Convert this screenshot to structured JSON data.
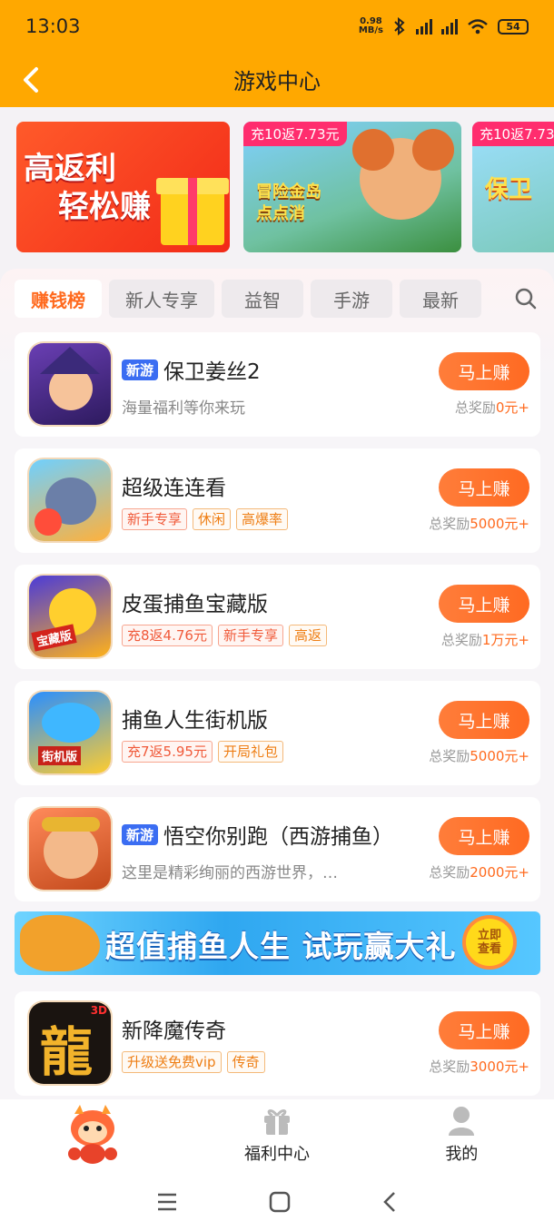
{
  "status_bar": {
    "time": "13:03",
    "net_speed_value": "0.98",
    "net_speed_unit": "MB/s",
    "battery": "54"
  },
  "nav": {
    "title": "游戏中心"
  },
  "banners": [
    {
      "line1": "高返利",
      "line2": "轻松赚"
    },
    {
      "tag": "充10返7.73元",
      "art_text": "冒险金岛点点消"
    },
    {
      "tag": "充10返7.73",
      "art_text": "保卫"
    }
  ],
  "tabs": [
    "赚钱榜",
    "新人专享",
    "益智",
    "手游",
    "最新"
  ],
  "games": [
    {
      "name": "保卫姜丝2",
      "badge": "新游",
      "desc": "海量福利等你来玩",
      "tags": [],
      "button": "马上赚",
      "reward_prefix": "总奖励",
      "reward_value": "0元+"
    },
    {
      "name": "超级连连看",
      "badge": "",
      "desc": "",
      "tags": [
        {
          "text": "新手专享",
          "style": "red"
        },
        {
          "text": "休闲",
          "style": "orange"
        },
        {
          "text": "高爆率",
          "style": "orange"
        }
      ],
      "button": "马上赚",
      "reward_prefix": "总奖励",
      "reward_value": "5000元+"
    },
    {
      "name": "皮蛋捕鱼宝藏版",
      "badge": "",
      "desc": "",
      "tags": [
        {
          "text": "充8返4.76元",
          "style": "red"
        },
        {
          "text": "新手专享",
          "style": "red"
        },
        {
          "text": "高返",
          "style": "orange"
        }
      ],
      "button": "马上赚",
      "reward_prefix": "总奖励",
      "reward_value": "1万元+"
    },
    {
      "name": "捕鱼人生街机版",
      "badge": "",
      "desc": "",
      "tags": [
        {
          "text": "充7返5.95元",
          "style": "red"
        },
        {
          "text": "开局礼包",
          "style": "orange"
        }
      ],
      "button": "马上赚",
      "reward_prefix": "总奖励",
      "reward_value": "5000元+"
    },
    {
      "name": "悟空你别跑（西游捕鱼）",
      "badge": "新游",
      "desc": "这里是精彩绚丽的西游世界，…",
      "tags": [],
      "button": "马上赚",
      "reward_prefix": "总奖励",
      "reward_value": "2000元+"
    },
    {
      "name": "新降魔传奇",
      "badge": "",
      "desc": "",
      "tags": [
        {
          "text": "升级送免费vip",
          "style": "orange"
        },
        {
          "text": "传奇",
          "style": "orange"
        }
      ],
      "button": "马上赚",
      "reward_prefix": "总奖励",
      "reward_value": "3000元+"
    }
  ],
  "promo": {
    "text": "超值捕鱼人生 试玩赢大礼",
    "cta_line1": "立即",
    "cta_line2": "查看"
  },
  "icon_art": {
    "game6_text": "龍",
    "game6_corner": "3D",
    "game3_ribbon": "宝藏版",
    "game4_ribbon": "街机版"
  },
  "tabbar": [
    {
      "label": "",
      "icon": "mascot-icon"
    },
    {
      "label": "福利中心",
      "icon": "gift-icon"
    },
    {
      "label": "我的",
      "icon": "user-icon"
    }
  ],
  "colors": {
    "header": "#ffa800",
    "accent": "#ff6a1e",
    "badge_new": "#3b6df2"
  }
}
